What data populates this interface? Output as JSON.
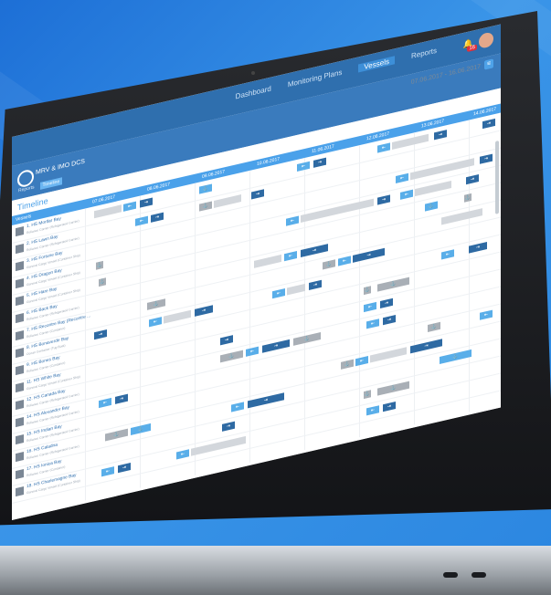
{
  "topnav": {
    "items": [
      "Dashboard",
      "Monitoring Plans",
      "Vessels",
      "Reports"
    ],
    "active": "Vessels",
    "notif_count": "16"
  },
  "app": {
    "title": "MRV & IMO DCS",
    "tabs": [
      "Reports",
      "Timeline"
    ],
    "active_tab": "Timeline",
    "date_range": "07.06.2017 - 16.06.2017"
  },
  "timeline": {
    "title": "Timeline",
    "vessels_header": "Vessels",
    "dates": [
      "07.06.2017",
      "08.06.2017",
      "09.06.2017",
      "10.06.2017",
      "11.06.2017",
      "12.06.2017",
      "13.06.2017",
      "14.06.2017"
    ],
    "vessels": [
      {
        "name": "1. HS Mortlar Bay",
        "sub": "Reliance Carrier (Refrigerated Carrier)"
      },
      {
        "name": "2. HS Lawn Bay",
        "sub": "Reliance Carrier (Refrigerated Carrier)"
      },
      {
        "name": "3. HS Fortune Bay",
        "sub": "General Cargo Vessel (Container Ship)"
      },
      {
        "name": "4. HS Dragon Bay",
        "sub": "General Cargo Vessel (Container Ship)"
      },
      {
        "name": "5. HS Hare Bay",
        "sub": "General Cargo Vessel (Container Ship)"
      },
      {
        "name": "6. HS Back Bay",
        "sub": "Reliance Carrier (Refrigerated Carrier)"
      },
      {
        "name": "7. HS Recontre Bay (Recontre ...",
        "sub": "Reliance Carrier (Container)"
      },
      {
        "name": "8. HS Bonaverde Bay",
        "sub": "Ocean Container (Tug Boat)"
      },
      {
        "name": "9. HS Bones Bay",
        "sub": "Reliance Carrier (Container)"
      },
      {
        "name": "11. HS White Bay",
        "sub": "General Cargo Vessel (Container Ship)"
      },
      {
        "name": "12. HS Canada Bay",
        "sub": "Reliance Carrier (Refrigerated Carrier)"
      },
      {
        "name": "14. HS Alexander Bay",
        "sub": "Reliance Carrier (Refrigerated Carrier)"
      },
      {
        "name": "15. HS Indian Bay",
        "sub": "Reliance Carrier (Refrigerated Carrier)"
      },
      {
        "name": "16. HS Caladna",
        "sub": "Reliance Carrier (Refrigerated Carrier)"
      },
      {
        "name": "17. HS Ionica Bay",
        "sub": "Reliance Carrier (Container)"
      },
      {
        "name": "18. HS Charlemagne Bay",
        "sub": "General Cargo Vessel (Container Ship)"
      }
    ]
  },
  "colors": {
    "accent": "#4aa1ea",
    "dark_blue": "#2e6aa3",
    "badge": "#e0303c"
  },
  "icons": [
    "bell-icon",
    "filter-icon",
    "logo-icon",
    "ship-icon",
    "arrow-in-icon",
    "arrow-out-icon",
    "anchor-icon"
  ]
}
